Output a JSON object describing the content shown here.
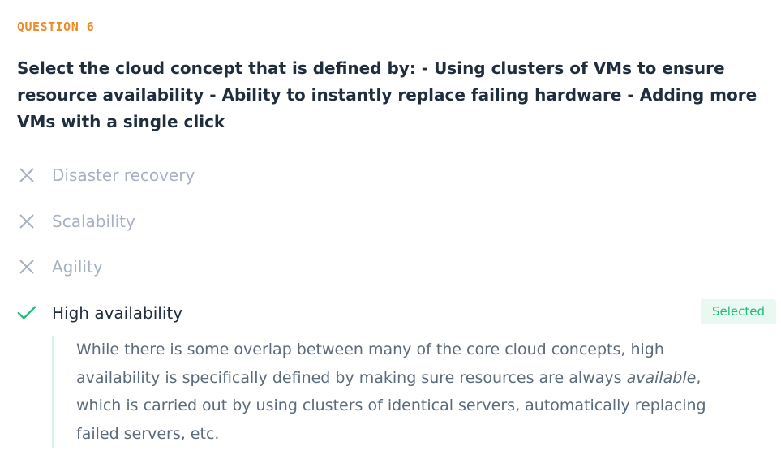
{
  "question": {
    "number_label": "QUESTION 6",
    "text": "Select the cloud concept that is defined by: - Using clusters of VMs to ensure resource availability - Ability to instantly replace failing hardware - Adding more VMs with a single click"
  },
  "options": [
    {
      "label": "Disaster recovery",
      "state": "incorrect",
      "icon": "x-icon"
    },
    {
      "label": "Scalability",
      "state": "incorrect",
      "icon": "x-icon"
    },
    {
      "label": "Agility",
      "state": "incorrect",
      "icon": "x-icon"
    },
    {
      "label": "High availability",
      "state": "correct",
      "icon": "check-icon"
    }
  ],
  "selected_badge": "Selected",
  "explanation": {
    "before": "While there is some overlap between many of the core cloud concepts, high availability is specifically defined by making sure resources are always ",
    "emphasis": "available",
    "after": ", which is carried out by using clusters of identical servers, automatically replacing failed servers, etc."
  },
  "colors": {
    "accent_orange": "#f08a24",
    "correct_green": "#1bbf7a",
    "muted_gray": "#a7b1c2",
    "text_dark": "#1f2d3d"
  }
}
